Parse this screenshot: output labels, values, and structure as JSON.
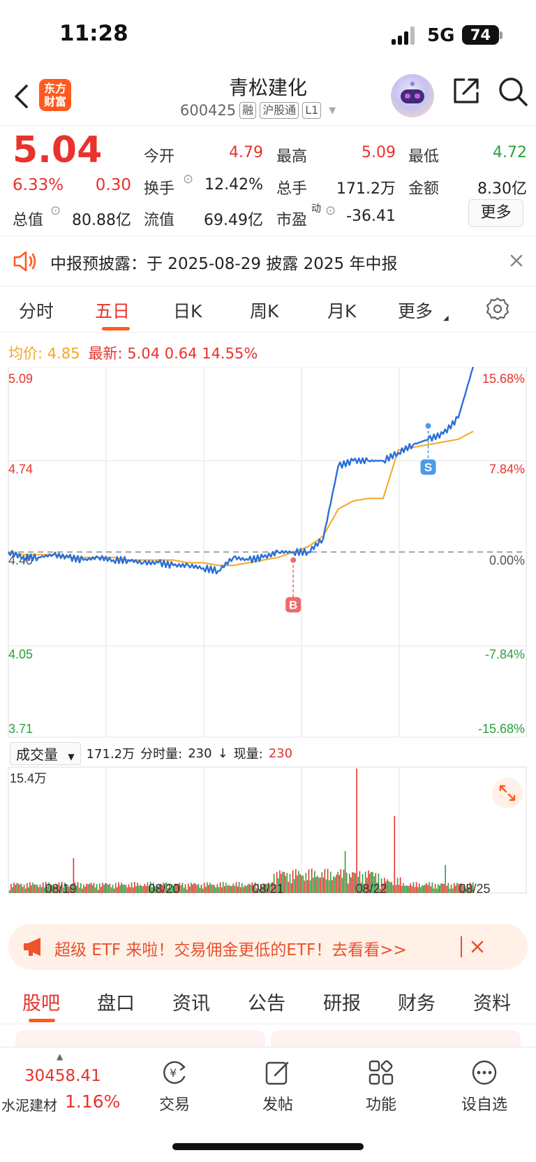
{
  "status_bar": {
    "time": "11:28",
    "network": "5G",
    "battery": "74"
  },
  "header": {
    "logo_text_1": "东方",
    "logo_text_2": "财富",
    "title": "青松建化",
    "code": "600425",
    "tags": [
      "融",
      "沪股通",
      "L1"
    ]
  },
  "quote": {
    "price": "5.04",
    "change_pct": "6.33%",
    "change": "0.30",
    "open_label": "今开",
    "open": "4.79",
    "high_label": "最高",
    "high": "5.09",
    "low_label": "最低",
    "low": "4.72",
    "turnover_label": "换手",
    "turnover": "12.42%",
    "volume_label": "总手",
    "volume": "171.2万",
    "amount_label": "金额",
    "amount": "8.30亿",
    "mktcap_label": "总值",
    "mktcap": "80.88亿",
    "float_label": "流值",
    "float_cap": "69.49亿",
    "pe_label": "市盈",
    "pe_sup": "动",
    "pe": "-36.41",
    "more_label": "更多"
  },
  "notice": {
    "text": "中报预披露：于 2025-08-29 披露 2025 年中报"
  },
  "chart_tabs": {
    "tabs": [
      "分时",
      "五日",
      "日K",
      "周K",
      "月K",
      "更多"
    ],
    "active": "五日"
  },
  "summary": {
    "avg_label": "均价:",
    "avg": "4.85",
    "latest_label": "最新:",
    "latest": "5.04",
    "change": "0.64",
    "change_pct": "14.55%"
  },
  "chart_data": {
    "type": "line",
    "title": "",
    "x": [
      "08/19",
      "08/20",
      "08/21",
      "08/22",
      "08/25"
    ],
    "ylim": [
      3.71,
      5.09
    ],
    "y_ticks_left": [
      "5.09",
      "4.74",
      "4.40",
      "4.05",
      "3.71"
    ],
    "y_ticks_right": [
      "15.68%",
      "7.84%",
      "0.00%",
      "-7.84%",
      "-15.68%"
    ],
    "prev_close": 4.4,
    "series": [
      {
        "name": "",
        "color": "#2b6fd6",
        "values": [
          4.4,
          4.38,
          4.38,
          4.39,
          4.38,
          4.37,
          4.38,
          4.37,
          4.37,
          4.36,
          4.36,
          4.35,
          4.35,
          4.34,
          4.33,
          4.38,
          4.37,
          4.38,
          4.4,
          4.4,
          4.4,
          4.45,
          4.72,
          4.74,
          4.74,
          4.74,
          4.77,
          4.8,
          4.82,
          4.84,
          4.9,
          5.09
        ]
      },
      {
        "name": "",
        "color": "#f5a623",
        "values": [
          4.4,
          4.39,
          4.39,
          4.39,
          4.38,
          4.38,
          4.38,
          4.38,
          4.37,
          4.37,
          4.37,
          4.37,
          4.36,
          4.36,
          4.35,
          4.35,
          4.36,
          4.37,
          4.38,
          4.4,
          4.42,
          4.46,
          4.56,
          4.59,
          4.6,
          4.6,
          4.78,
          4.79,
          4.8,
          4.81,
          4.82,
          4.85
        ]
      }
    ],
    "markers": [
      {
        "label": "B",
        "x_index": 19,
        "value": 4.37,
        "color": "#f06a6a"
      },
      {
        "label": "S",
        "x_index": 28,
        "value": 4.87,
        "color": "#4a9be8"
      }
    ],
    "volume": {
      "label": "成交量",
      "total": "171.2万",
      "minute_label": "分时量:",
      "minute": "230",
      "current_label": "现量:",
      "current": "230",
      "max_label": "15.4万"
    }
  },
  "banner": {
    "text": "超级 ETF 来啦！交易佣金更低的ETF！去看看>>"
  },
  "bottom_tabs": {
    "tabs": [
      "股吧",
      "盘口",
      "资讯",
      "公告",
      "研报",
      "财务",
      "资料"
    ],
    "active": "股吧"
  },
  "nav": {
    "index_value": "30458.41",
    "index_name": "水泥建材",
    "index_pct": "1.16%",
    "items": [
      "交易",
      "发帖",
      "功能",
      "设自选"
    ]
  },
  "colors": {
    "up": "#e8322b",
    "down": "#27a23c",
    "accent": "#ff5a1e",
    "avg": "#f5a623",
    "price_line": "#2b6fd6"
  }
}
